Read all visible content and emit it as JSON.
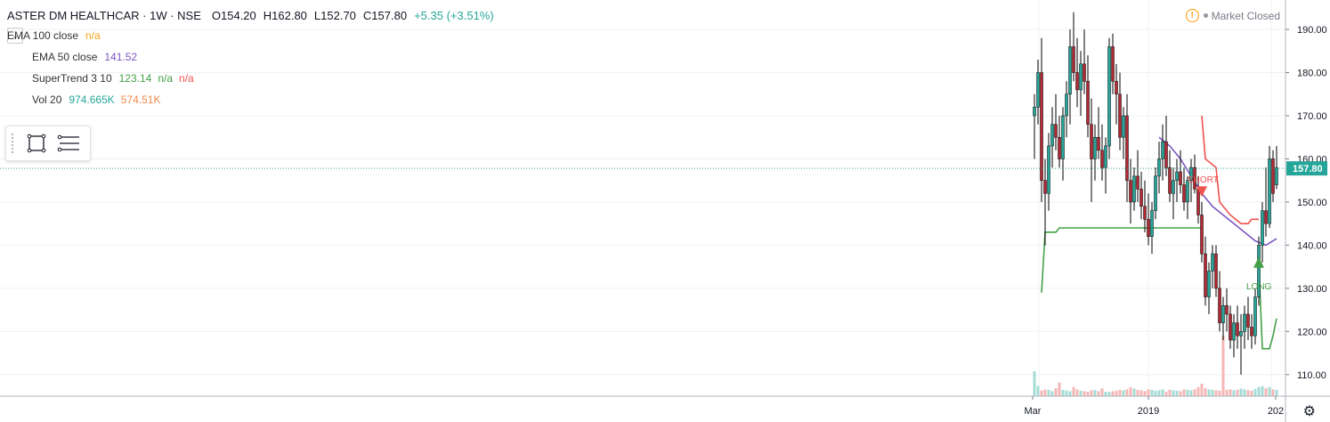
{
  "header": {
    "symbol": "ASTER DM HEALTHCAR · 1W · NSE",
    "open": "O154.20",
    "high": "H162.80",
    "low": "L152.70",
    "close": "C157.80",
    "change": "+5.35 (+3.51%)"
  },
  "indicators": {
    "ema100": {
      "name": "EMA 100 close",
      "value": "n/a"
    },
    "ema50": {
      "name": "EMA 50 close",
      "value": "141.52"
    },
    "supertrend": {
      "name": "SuperTrend 3 10",
      "value1": "123.14",
      "value2": "n/a",
      "value3": "n/a"
    },
    "vol": {
      "name": "Vol 20",
      "value1": "974.665K",
      "value2": "574.51K"
    }
  },
  "status": {
    "market": "Market Closed"
  },
  "icons": [
    "chevron-down-icon",
    "rectangle-tool-icon",
    "menu-lines-icon",
    "warning-icon",
    "gear-icon"
  ],
  "colors": {
    "up": "#26a69a",
    "down": "#ef5350",
    "ema50": "#7e57c2",
    "st_up": "#43a047",
    "st_down": "#ef5350",
    "price_tag": "#26a69a"
  },
  "chart_data": {
    "type": "candlestick",
    "yaxis": {
      "ticks": [
        110,
        120,
        130,
        140,
        150,
        160,
        170,
        180,
        190
      ],
      "range": [
        105,
        196
      ]
    },
    "xaxis": {
      "tick_labels": [
        "Mar",
        "2019",
        "202"
      ]
    },
    "last_price": "157.80",
    "annotations": [
      "SHORT",
      "LONG"
    ],
    "candles": [
      [
        170,
        175,
        160,
        172
      ],
      [
        172,
        183,
        168,
        180
      ],
      [
        180,
        188,
        150,
        155
      ],
      [
        155,
        160,
        140,
        152
      ],
      [
        152,
        166,
        148,
        163
      ],
      [
        163,
        172,
        158,
        168
      ],
      [
        168,
        175,
        162,
        165
      ],
      [
        165,
        170,
        158,
        160
      ],
      [
        160,
        172,
        155,
        170
      ],
      [
        170,
        178,
        165,
        175
      ],
      [
        175,
        190,
        168,
        186
      ],
      [
        186,
        194,
        178,
        180
      ],
      [
        180,
        188,
        172,
        176
      ],
      [
        176,
        185,
        170,
        182
      ],
      [
        182,
        190,
        175,
        178
      ],
      [
        178,
        184,
        165,
        168
      ],
      [
        168,
        174,
        150,
        160
      ],
      [
        160,
        168,
        155,
        165
      ],
      [
        165,
        172,
        160,
        162
      ],
      [
        162,
        168,
        155,
        158
      ],
      [
        158,
        165,
        152,
        163
      ],
      [
        163,
        188,
        160,
        186
      ],
      [
        186,
        189,
        175,
        178
      ],
      [
        178,
        182,
        168,
        175
      ],
      [
        175,
        180,
        162,
        165
      ],
      [
        165,
        172,
        160,
        170
      ],
      [
        170,
        175,
        150,
        155
      ],
      [
        155,
        160,
        145,
        150
      ],
      [
        150,
        158,
        148,
        156
      ],
      [
        156,
        162,
        150,
        153
      ],
      [
        153,
        157,
        146,
        149
      ],
      [
        149,
        155,
        143,
        146
      ],
      [
        146,
        152,
        140,
        142
      ],
      [
        142,
        150,
        138,
        148
      ],
      [
        148,
        158,
        146,
        156
      ],
      [
        156,
        164,
        152,
        160
      ],
      [
        160,
        168,
        155,
        164
      ],
      [
        164,
        170,
        156,
        158
      ],
      [
        158,
        162,
        150,
        152
      ],
      [
        152,
        158,
        146,
        155
      ],
      [
        155,
        160,
        150,
        157
      ],
      [
        157,
        162,
        152,
        154
      ],
      [
        154,
        158,
        148,
        150
      ],
      [
        150,
        156,
        146,
        155
      ],
      [
        155,
        160,
        150,
        158
      ],
      [
        158,
        161,
        152,
        153
      ],
      [
        153,
        156,
        145,
        147
      ],
      [
        147,
        150,
        136,
        138
      ],
      [
        138,
        142,
        126,
        128
      ],
      [
        128,
        136,
        124,
        134
      ],
      [
        134,
        140,
        130,
        138
      ],
      [
        138,
        140,
        128,
        130
      ],
      [
        130,
        134,
        120,
        122
      ],
      [
        122,
        128,
        118,
        126
      ],
      [
        126,
        130,
        120,
        124
      ],
      [
        124,
        126,
        116,
        118
      ],
      [
        118,
        124,
        114,
        122
      ],
      [
        122,
        126,
        116,
        119
      ],
      [
        119,
        124,
        110,
        120
      ],
      [
        120,
        126,
        116,
        124
      ],
      [
        124,
        128,
        118,
        121
      ],
      [
        121,
        124,
        116,
        119
      ],
      [
        119,
        130,
        117,
        128
      ],
      [
        128,
        142,
        126,
        140
      ],
      [
        140,
        150,
        136,
        148
      ],
      [
        148,
        158,
        142,
        145
      ],
      [
        145,
        163,
        144,
        160
      ],
      [
        160,
        162,
        150,
        152
      ],
      [
        154,
        163,
        153,
        158
      ]
    ],
    "volumes": [
      110,
      45,
      25,
      30,
      28,
      22,
      35,
      60,
      28,
      25,
      22,
      40,
      30,
      24,
      22,
      20,
      26,
      28,
      22,
      35,
      20,
      18,
      22,
      24,
      28,
      26,
      30,
      40,
      34,
      28,
      26,
      22,
      30,
      28,
      24,
      26,
      30,
      20,
      28,
      26,
      24,
      22,
      30,
      28,
      26,
      30,
      40,
      55,
      35,
      30,
      28,
      26,
      24,
      32,
      28,
      30,
      26,
      28,
      34,
      30,
      26,
      24,
      32,
      40,
      45,
      35,
      40,
      30,
      28
    ],
    "ema50": [
      [
        35,
        165
      ],
      [
        38,
        163
      ],
      [
        41,
        160
      ],
      [
        44,
        156
      ],
      [
        47,
        152
      ],
      [
        50,
        149
      ],
      [
        53,
        147
      ],
      [
        56,
        145
      ],
      [
        59,
        143
      ],
      [
        62,
        141
      ],
      [
        65,
        140
      ],
      [
        68,
        141.5
      ]
    ],
    "supertrend_up_1": [
      [
        2,
        129
      ],
      [
        3,
        143
      ],
      [
        6,
        143
      ],
      [
        7,
        144
      ],
      [
        47,
        144
      ]
    ],
    "supertrend_down": [
      [
        47,
        170
      ],
      [
        48,
        160
      ],
      [
        51,
        158
      ],
      [
        52,
        150
      ],
      [
        55,
        147
      ],
      [
        58,
        145
      ],
      [
        60,
        145
      ],
      [
        61,
        146
      ],
      [
        63,
        146
      ]
    ],
    "supertrend_up_2": [
      [
        63,
        136
      ],
      [
        64,
        116
      ],
      [
        66,
        116
      ],
      [
        67,
        119
      ],
      [
        68,
        123
      ]
    ]
  }
}
